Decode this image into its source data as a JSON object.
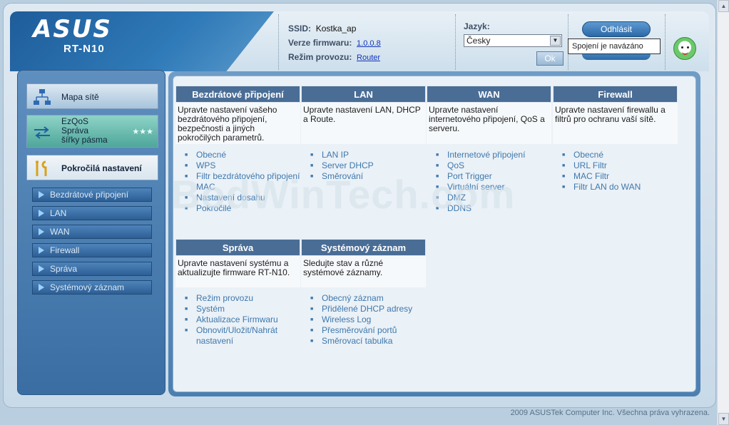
{
  "header": {
    "brand": "ASUS",
    "model": "RT-N10",
    "ssid_label": "SSID:",
    "ssid_value": "Kostka_ap",
    "firmware_label": "Verze firmwaru:",
    "firmware_value": "1.0.0.8",
    "mode_label": "Režim provozu:",
    "mode_value": "Router",
    "language_label": "Jazyk:",
    "language_value": "Česky",
    "ok_label": "Ok",
    "logout_label": "Odhlásit",
    "connection_tooltip": "Spojení je navázáno"
  },
  "sidebar": {
    "network_map": "Mapa sítě",
    "ezqos": [
      "EzQoS",
      "Správa",
      "šířky pásma"
    ],
    "advanced": "Pokročilá nastavení",
    "submenu": [
      "Bezdrátové připojení",
      "LAN",
      "WAN",
      "Firewall",
      "Správa",
      "Systémový záznam"
    ]
  },
  "sections": [
    {
      "title": "Bezdrátové připojení",
      "desc": "Upravte nastavení vašeho bezdrátového připojení, bezpečnosti a jiných pokročilých parametrů.",
      "links": [
        "Obecné",
        "WPS",
        "Filtr bezdrátového připojení MAC",
        "Nastavení dosahu",
        "Pokročilé"
      ]
    },
    {
      "title": "LAN",
      "desc": "Upravte nastavení LAN, DHCP a Route.",
      "links": [
        "LAN IP",
        "Server DHCP",
        "Směrování"
      ]
    },
    {
      "title": "WAN",
      "desc": "Upravte nastavení internetového připojení, QoS a serveru.",
      "links": [
        "Internetové připojení",
        "QoS",
        "Port Trigger",
        "Virtuální server",
        "DMZ",
        "DDNS"
      ]
    },
    {
      "title": "Firewall",
      "desc": "Upravte nastavení firewallu a filtrů pro ochranu vaší sítě.",
      "links": [
        "Obecné",
        "URL Filtr",
        "MAC Filtr",
        "Filtr LAN do WAN"
      ]
    },
    {
      "title": "Správa",
      "desc": "Upravte nastavení systému a aktualizujte firmware RT-N10.",
      "links": [
        "Režim provozu",
        "Systém",
        "Aktualizace Firmwaru",
        "Obnovit/Uložit/Nahrát nastavení"
      ]
    },
    {
      "title": "Systémový záznam",
      "desc": "Sledujte stav a různé systémové záznamy.",
      "links": [
        "Obecný záznam",
        "Přidělené DHCP adresy",
        "Wireless Log",
        "Přesměrování portů",
        "Směrovací tabulka"
      ]
    }
  ],
  "footer": "2009 ASUSTek Computer Inc. Všechna práva vyhrazena.",
  "watermark": "BodWinTech.com"
}
